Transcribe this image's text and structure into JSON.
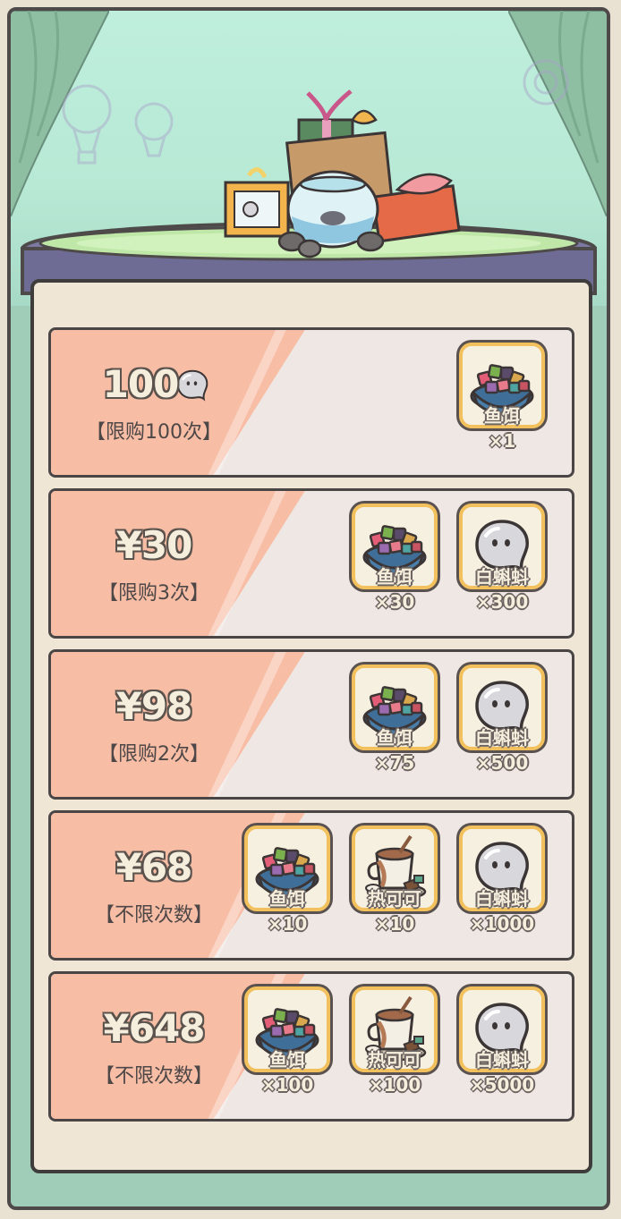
{
  "cards": [
    {
      "price": "100",
      "currency_icon": "white-tadpole-icon",
      "limit": "【限购100次】",
      "items": [
        {
          "icon": "fish-bait-icon",
          "name": "鱼饵",
          "qty": "×1"
        }
      ]
    },
    {
      "price": "¥30",
      "limit": "【限购3次】",
      "items": [
        {
          "icon": "fish-bait-icon",
          "name": "鱼饵",
          "qty": "×30"
        },
        {
          "icon": "white-tadpole-icon",
          "name": "白蝌蚪",
          "qty": "×300"
        }
      ]
    },
    {
      "price": "¥98",
      "limit": "【限购2次】",
      "items": [
        {
          "icon": "fish-bait-icon",
          "name": "鱼饵",
          "qty": "×75"
        },
        {
          "icon": "white-tadpole-icon",
          "name": "白蝌蚪",
          "qty": "×500"
        }
      ]
    },
    {
      "price": "¥68",
      "limit": "【不限次数】",
      "items": [
        {
          "icon": "fish-bait-icon",
          "name": "鱼饵",
          "qty": "×10"
        },
        {
          "icon": "hot-cocoa-icon",
          "name": "热可可",
          "qty": "×10"
        },
        {
          "icon": "white-tadpole-icon",
          "name": "白蝌蚪",
          "qty": "×1000"
        }
      ]
    },
    {
      "price": "¥648",
      "limit": "【不限次数】",
      "items": [
        {
          "icon": "fish-bait-icon",
          "name": "鱼饵",
          "qty": "×100"
        },
        {
          "icon": "hot-cocoa-icon",
          "name": "热可可",
          "qty": "×100"
        },
        {
          "icon": "white-tadpole-icon",
          "name": "白蝌蚪",
          "qty": "×5000"
        }
      ]
    }
  ],
  "colors": {
    "panel": "#efe6d6",
    "stripe": "#f8bda5",
    "slot_border": "#f2c15d",
    "stage": "#bfeedd"
  }
}
